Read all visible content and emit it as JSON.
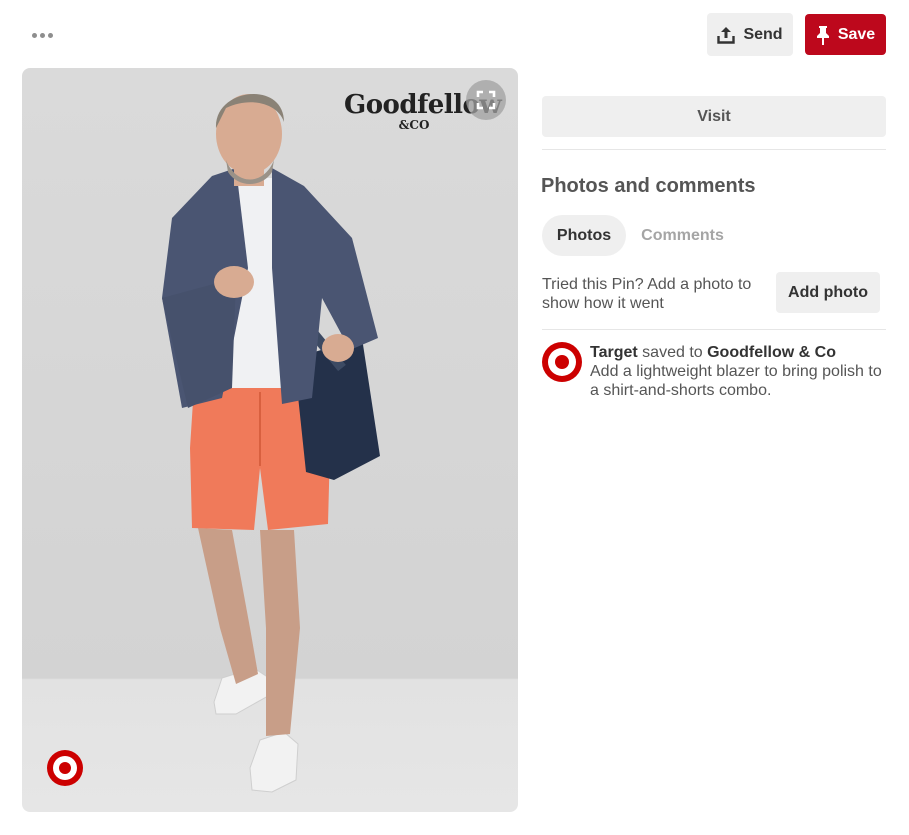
{
  "header": {
    "more_icon": "more-horizontal-icon",
    "send_label": "Send",
    "send_icon": "share-upload-icon",
    "save_label": "Save",
    "save_icon": "pushpin-icon",
    "save_color": "#bd081c"
  },
  "pin": {
    "brand_logo_name": "Goodfellow",
    "brand_logo_sub": "&CO",
    "expand_icon": "expand-icon",
    "badge_icon": "target-logo-icon"
  },
  "sidebar": {
    "visit_label": "Visit",
    "section_title": "Photos and comments",
    "tabs": [
      {
        "label": "Photos",
        "active": true
      },
      {
        "label": "Comments",
        "active": false
      }
    ],
    "add_photo_prompt": "Tried this Pin? Add a photo to show how it went",
    "add_photo_label": "Add photo",
    "saver": {
      "name": "Target",
      "saved_to_text": "saved to",
      "board": "Goodfellow & Co",
      "description": "Add a lightweight blazer to bring polish to a shirt-and-shorts combo.",
      "brand_color": "#cc0000"
    }
  }
}
